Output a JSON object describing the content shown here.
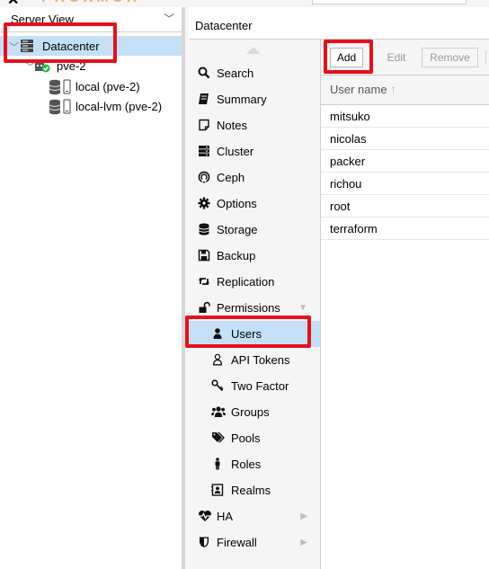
{
  "colors": {
    "selection": "#c3e0f7",
    "highlight": "#e8101a",
    "panel_bg": "#f5f5f5"
  },
  "tree": {
    "view_label": "Server View",
    "items": [
      {
        "label": "Datacenter",
        "icon": "datacenter-icon"
      },
      {
        "label": "pve-2",
        "icon": "node-icon"
      },
      {
        "label": "local (pve-2)",
        "icon": "storage-icon"
      },
      {
        "label": "local-lvm (pve-2)",
        "icon": "storage-icon"
      }
    ]
  },
  "title": "Datacenter",
  "nav": {
    "items": [
      {
        "label": "Search",
        "icon": "search-icon"
      },
      {
        "label": "Summary",
        "icon": "book-icon"
      },
      {
        "label": "Notes",
        "icon": "note-icon"
      },
      {
        "label": "Cluster",
        "icon": "server-icon"
      },
      {
        "label": "Ceph",
        "icon": "ceph-icon"
      },
      {
        "label": "Options",
        "icon": "gear-icon"
      },
      {
        "label": "Storage",
        "icon": "database-icon"
      },
      {
        "label": "Backup",
        "icon": "floppy-icon"
      },
      {
        "label": "Replication",
        "icon": "retweet-icon"
      },
      {
        "label": "Permissions",
        "icon": "unlock-icon"
      },
      {
        "label": "Users",
        "icon": "user-icon"
      },
      {
        "label": "API Tokens",
        "icon": "user-outline-icon"
      },
      {
        "label": "Two Factor",
        "icon": "key-icon"
      },
      {
        "label": "Groups",
        "icon": "users-icon"
      },
      {
        "label": "Pools",
        "icon": "tags-icon"
      },
      {
        "label": "Roles",
        "icon": "male-icon"
      },
      {
        "label": "Realms",
        "icon": "address-book-icon"
      },
      {
        "label": "HA",
        "icon": "heartbeat-icon"
      },
      {
        "label": "Firewall",
        "icon": "shield-icon"
      }
    ]
  },
  "toolbar": {
    "add_label": "Add",
    "edit_label": "Edit",
    "remove_label": "Remove"
  },
  "grid": {
    "column": "User name",
    "rows": [
      "mitsuko",
      "nicolas",
      "packer",
      "richou",
      "root",
      "terraform"
    ]
  }
}
